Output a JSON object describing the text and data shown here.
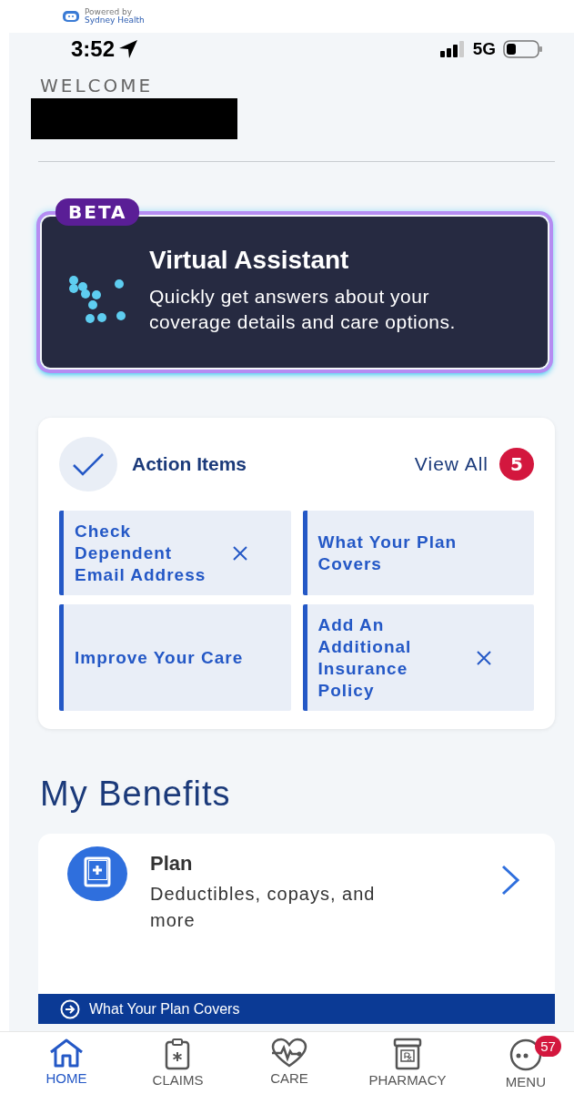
{
  "logo": {
    "powered_by": "Powered by",
    "name": "Sydney Health"
  },
  "status_bar": {
    "time": "3:52",
    "network": "5G"
  },
  "welcome": "WELCOME",
  "assistant": {
    "badge": "BETA",
    "title": "Virtual Assistant",
    "description": "Quickly get answers about your coverage details and care options."
  },
  "action_items": {
    "title": "Action Items",
    "view_all": "View All",
    "count": "5",
    "items": [
      {
        "label": "Check Dependent Email Address",
        "dismissible": true
      },
      {
        "label": "What Your Plan Covers",
        "dismissible": false
      },
      {
        "label": "Improve Your Care",
        "dismissible": false
      },
      {
        "label": "Add An Additional Insurance Policy",
        "dismissible": true
      }
    ]
  },
  "benefits": {
    "heading": "My Benefits",
    "cards": [
      {
        "title": "Plan",
        "description": "Deductibles, copays, and more"
      }
    ],
    "banner": "What Your Plan Covers"
  },
  "nav": [
    {
      "kind": "home",
      "label": "HOME",
      "selected": true
    },
    {
      "kind": "claims",
      "label": "CLAIMS",
      "selected": false
    },
    {
      "kind": "care",
      "label": "CARE",
      "selected": false
    },
    {
      "kind": "pharmacy",
      "label": "PHARMACY",
      "selected": false
    },
    {
      "kind": "menu",
      "label": "MENU",
      "selected": false,
      "badge": "57"
    }
  ]
}
